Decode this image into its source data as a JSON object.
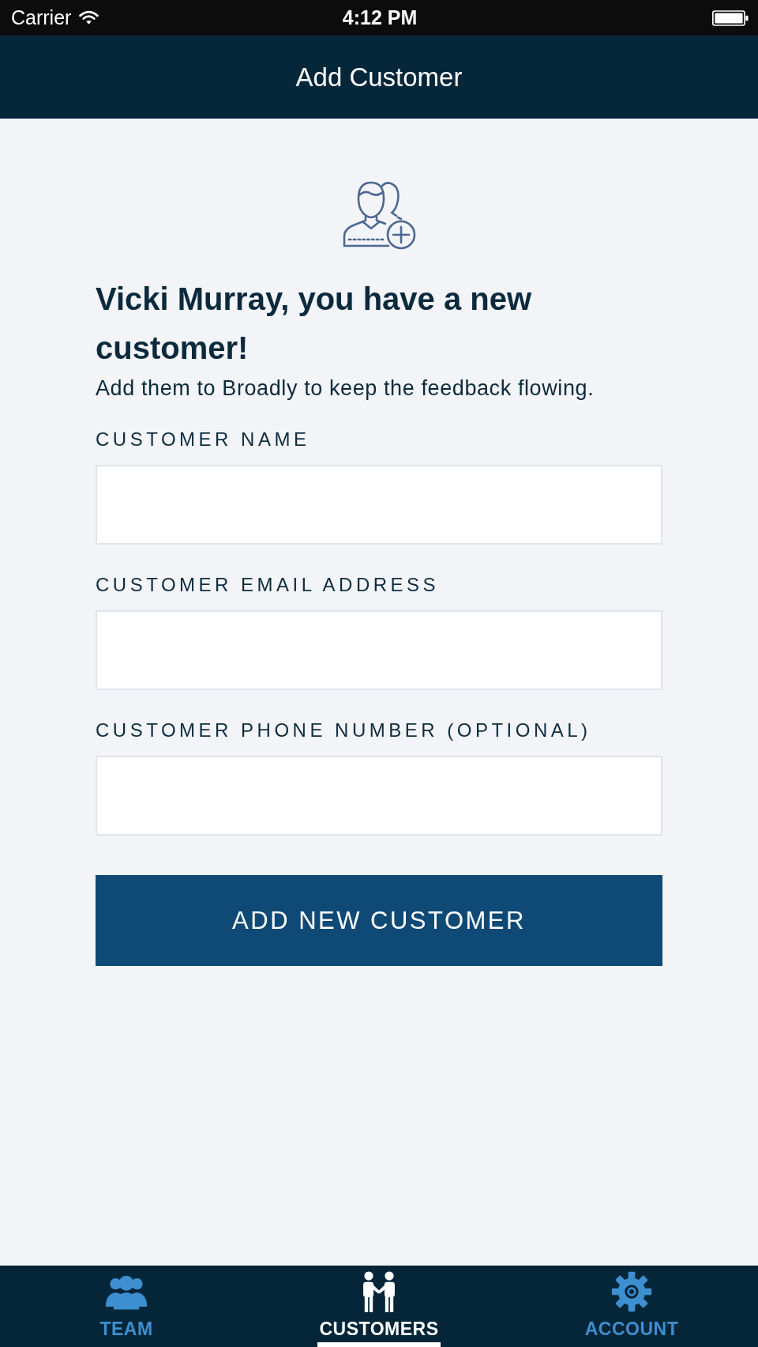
{
  "status_bar": {
    "carrier": "Carrier",
    "time": "4:12 PM"
  },
  "header": {
    "title": "Add Customer"
  },
  "intro": {
    "heading": "Vicki Murray, you have a new customer!",
    "subtitle": "Add them to Broadly to keep the feedback flowing."
  },
  "fields": [
    {
      "label": "CUSTOMER NAME"
    },
    {
      "label": "CUSTOMER EMAIL ADDRESS"
    },
    {
      "label": "CUSTOMER PHONE NUMBER (OPTIONAL)"
    }
  ],
  "submit_button": {
    "label": "ADD NEW CUSTOMER"
  },
  "tab_bar": {
    "tabs": [
      {
        "label": "TEAM",
        "kind": "team",
        "selected": false
      },
      {
        "label": "CUSTOMERS",
        "kind": "customers",
        "selected": true
      },
      {
        "label": "ACCOUNT",
        "kind": "account",
        "selected": false
      }
    ]
  }
}
